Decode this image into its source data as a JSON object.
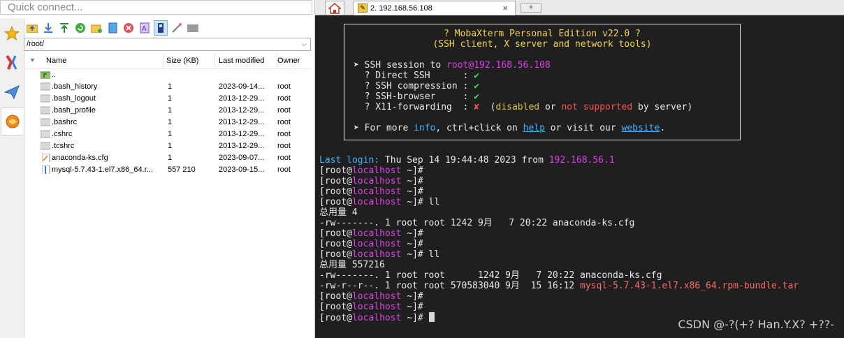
{
  "quick_connect": {
    "placeholder": "Quick connect..."
  },
  "side_tabs": [
    "star-icon",
    "tools-icon",
    "paper-plane-icon",
    "sftp-icon"
  ],
  "toolbar": [
    "folder-up-icon",
    "download-icon",
    "upload-icon",
    "refresh-icon",
    "new-folder-icon",
    "new-file-icon",
    "delete-icon",
    "rename-icon",
    "permissions-icon",
    "magic-icon",
    "terminal-icon"
  ],
  "path": {
    "value": "/root/"
  },
  "columns": {
    "name": "Name",
    "size": "Size (KB)",
    "modified": "Last modified",
    "owner": "Owner"
  },
  "files": [
    {
      "name": "..",
      "size": "",
      "modified": "",
      "owner": "",
      "kind": "parent"
    },
    {
      "name": ".bash_history",
      "size": "1",
      "modified": "2023-09-14...",
      "owner": "root",
      "kind": "hidden"
    },
    {
      "name": ".bash_logout",
      "size": "1",
      "modified": "2013-12-29...",
      "owner": "root",
      "kind": "hidden"
    },
    {
      "name": ".bash_profile",
      "size": "1",
      "modified": "2013-12-29...",
      "owner": "root",
      "kind": "hidden"
    },
    {
      "name": ".bashrc",
      "size": "1",
      "modified": "2013-12-29...",
      "owner": "root",
      "kind": "hidden"
    },
    {
      "name": ".cshrc",
      "size": "1",
      "modified": "2013-12-29...",
      "owner": "root",
      "kind": "hidden"
    },
    {
      "name": ".tcshrc",
      "size": "1",
      "modified": "2013-12-29...",
      "owner": "root",
      "kind": "hidden"
    },
    {
      "name": "anaconda-ks.cfg",
      "size": "1",
      "modified": "2023-09-07...",
      "owner": "root",
      "kind": "file"
    },
    {
      "name": "mysql-5.7.43-1.el7.x86_64.r...",
      "size": "557 210",
      "modified": "2023-09-15...",
      "owner": "root",
      "kind": "archive"
    }
  ],
  "tabs": {
    "session_label": "2. 192.168.56.108",
    "close": "×",
    "new": "+"
  },
  "banner": {
    "title": "? MobaXterm Personal Edition v22.0 ?",
    "subtitle": "(SSH client, X server and network tools)",
    "session_prefix": "➤ SSH session to ",
    "session_target": "root@192.168.56.108",
    "features": [
      {
        "label": "  ? Direct SSH      : ",
        "status": "✔",
        "ok": true
      },
      {
        "label": "  ? SSH compression : ",
        "status": "✔",
        "ok": true
      },
      {
        "label": "  ? SSH-browser     : ",
        "status": "✔",
        "ok": true
      },
      {
        "label": "  ? X11-forwarding  : ",
        "status": "✘",
        "ok": false
      }
    ],
    "x11_open": "  (",
    "x11_disabled": "disabled",
    "x11_or": " or ",
    "x11_notsupported": "not supported",
    "x11_by": " by server)",
    "info_prefix": "➤ For more ",
    "info_word": "info",
    "info_mid": ", ctrl+click on ",
    "help_link": "help",
    "info_mid2": " or visit our ",
    "website_link": "website",
    "info_end": "."
  },
  "terminal": {
    "lastlogin_label": "Last login:",
    "lastlogin_text": " Thu Sep 14 19:44:48 2023 from ",
    "lastlogin_ip": "192.168.56.1",
    "prompt_open": "[root@",
    "prompt_host": "localhost",
    "prompt_close": " ~]#",
    "cmd_ll": " ll",
    "total1": "总用量 4",
    "ls1": "-rw-------. 1 root root 1242 9月   7 20:22 anaconda-ks.cfg",
    "total2": "总用量 557216",
    "ls2": "-rw-------. 1 root root      1242 9月   7 20:22 anaconda-ks.cfg",
    "ls3_prefix": "-rw-r--r--. 1 root root 570583040 9月  15 16:12 ",
    "ls3_file": "mysql-5.7.43-1.el7.x86_64.rpm-bundle.tar"
  },
  "watermark": "CSDN @-?(+? Han.Y.X? +??-"
}
